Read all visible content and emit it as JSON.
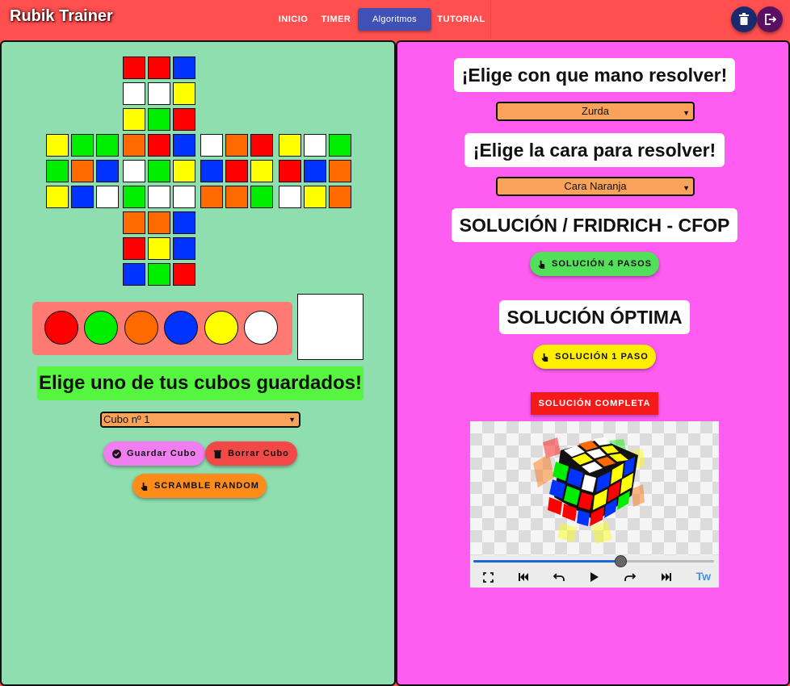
{
  "header": {
    "brand": "Rubik Trainer",
    "nav": [
      {
        "label": "INICIO",
        "active": false
      },
      {
        "label": "TIMER",
        "active": false
      },
      {
        "label": "Algoritmos",
        "active": true
      },
      {
        "label": "TUTORIAL",
        "active": false
      }
    ],
    "delete_icon": "trash-icon",
    "logout_icon": "logout-icon"
  },
  "colors": {
    "R": "#ff0000",
    "G": "#00ee00",
    "B": "#0033ff",
    "W": "#ffffff",
    "Y": "#ffff00",
    "O": "#ff6a00"
  },
  "cube_net": {
    "U": [
      "RRB",
      "WWY",
      "YGR"
    ],
    "L": [
      "YGG",
      "GOB",
      "YBW"
    ],
    "F": [
      "ORB",
      "WGY",
      "GWW"
    ],
    "R": [
      "WOR",
      "BRY",
      "OOG"
    ],
    "B": [
      "YWG",
      "RBO",
      "WYO"
    ],
    "D": [
      "OOB",
      "RYB",
      "BGR"
    ]
  },
  "palette": [
    "#ff0000",
    "#00ee00",
    "#ff6a00",
    "#0033ff",
    "#ffff00",
    "#ffffff"
  ],
  "selected_color": "#ffffff",
  "left": {
    "saved_title": "Elige uno de tus cubos guardados!",
    "saved_select": "Cubo nº 1",
    "save_btn": "Guardar Cubo",
    "delete_btn": "Borrar Cubo",
    "scramble_btn": "SCRAMBLE RANDOM"
  },
  "right": {
    "hand_title": "¡Elige con que mano resolver!",
    "hand_select": "Zurda",
    "face_title": "¡Elige la cara para resolver!",
    "face_select": "Cara Naranja",
    "cfop_title": "SOLUCIÓN / FRIDRICH - CFOP",
    "cfop_btn": "SOLUCIÓN 4 PASOS",
    "optimal_title": "SOLUCIÓN ÓPTIMA",
    "optimal_btn": "SOLUCIÓN 1 PASO",
    "full_btn": "SOLUCIÓN COMPLETA"
  },
  "player": {
    "progress": 0.61,
    "tw_label": "Tw",
    "icons": [
      "fullscreen-icon",
      "skip-back-icon",
      "step-back-icon",
      "play-icon",
      "step-forward-icon",
      "skip-forward-icon"
    ]
  }
}
